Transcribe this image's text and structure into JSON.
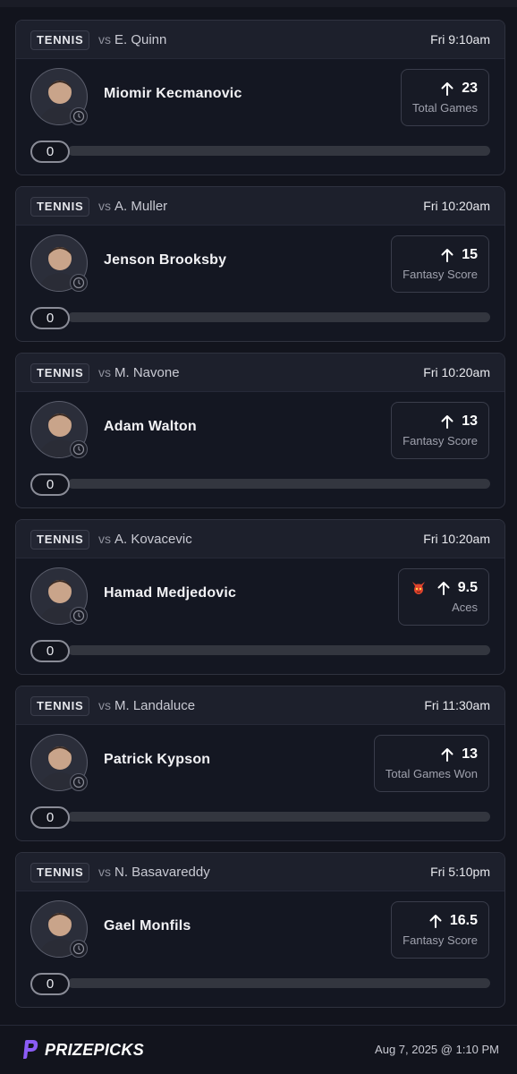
{
  "colors": {
    "background": "#12141d",
    "card": "#141722",
    "card_header": "#1d202c",
    "accent": "#6a4df7",
    "demon": "#e0442c"
  },
  "cards": [
    {
      "sport": "TENNIS",
      "vs": "vs",
      "opponent": "E. Quinn",
      "time": "Fri 9:10am",
      "player": "Miomir Kecmanovic",
      "direction": "up",
      "line": "23",
      "stat": "Total Games",
      "count": "0",
      "progress": 0,
      "demon": false
    },
    {
      "sport": "TENNIS",
      "vs": "vs",
      "opponent": "A. Muller",
      "time": "Fri 10:20am",
      "player": "Jenson Brooksby",
      "direction": "up",
      "line": "15",
      "stat": "Fantasy Score",
      "count": "0",
      "progress": 0,
      "demon": false
    },
    {
      "sport": "TENNIS",
      "vs": "vs",
      "opponent": "M. Navone",
      "time": "Fri 10:20am",
      "player": "Adam Walton",
      "direction": "up",
      "line": "13",
      "stat": "Fantasy Score",
      "count": "0",
      "progress": 0,
      "demon": false
    },
    {
      "sport": "TENNIS",
      "vs": "vs",
      "opponent": "A. Kovacevic",
      "time": "Fri 10:20am",
      "player": "Hamad Medjedovic",
      "direction": "up",
      "line": "9.5",
      "stat": "Aces",
      "count": "0",
      "progress": 0,
      "demon": true
    },
    {
      "sport": "TENNIS",
      "vs": "vs",
      "opponent": "M. Landaluce",
      "time": "Fri 11:30am",
      "player": "Patrick Kypson",
      "direction": "up",
      "line": "13",
      "stat": "Total Games Won",
      "count": "0",
      "progress": 0,
      "demon": false
    },
    {
      "sport": "TENNIS",
      "vs": "vs",
      "opponent": "N. Basavareddy",
      "time": "Fri 5:10pm",
      "player": "Gael Monfils",
      "direction": "up",
      "line": "16.5",
      "stat": "Fantasy Score",
      "count": "0",
      "progress": 0,
      "demon": false
    }
  ],
  "footer": {
    "brand": "PRIZEPICKS",
    "timestamp": "Aug 7, 2025 @ 1:10 PM"
  }
}
